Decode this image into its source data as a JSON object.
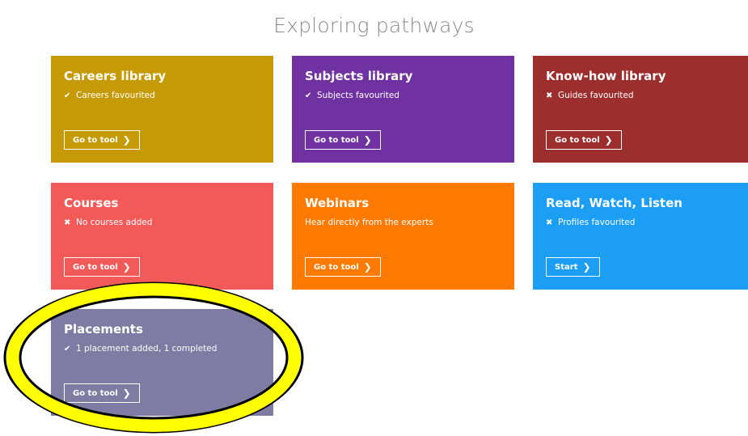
{
  "page": {
    "title": "Exploring pathways"
  },
  "colors": {
    "careers": "#c59a05",
    "subjects": "#7032a0",
    "knowhow": "#9c2e2e",
    "courses": "#f25a5a",
    "webinars": "#fe7a00",
    "readwatch": "#1c9ef5",
    "placements": "#807ba3",
    "highlight": "#ffff00"
  },
  "tiles": [
    {
      "title": "Careers library",
      "status_icon": "✔",
      "status_icon_name": "check-icon",
      "status": "Careers favourited",
      "button": "Go to tool"
    },
    {
      "title": "Subjects library",
      "status_icon": "✔",
      "status_icon_name": "check-icon",
      "status": "Subjects favourited",
      "button": "Go to tool"
    },
    {
      "title": "Know-how library",
      "status_icon": "✖",
      "status_icon_name": "cross-icon",
      "status": "Guides favourited",
      "button": "Go to tool"
    },
    {
      "title": "Courses",
      "status_icon": "✖",
      "status_icon_name": "cross-icon",
      "status": "No courses added",
      "button": "Go to tool"
    },
    {
      "title": "Webinars",
      "status_icon": "",
      "status_icon_name": "",
      "status": "Hear directly from the experts",
      "button": "Go to tool"
    },
    {
      "title": "Read, Watch, Listen",
      "status_icon": "✖",
      "status_icon_name": "cross-icon",
      "status": "Profiles favourited",
      "button": "Start"
    },
    {
      "title": "Placements",
      "status_icon": "✔",
      "status_icon_name": "check-icon",
      "status": "1 placement added, 1 completed",
      "button": "Go to tool"
    }
  ],
  "chevron": "❯"
}
